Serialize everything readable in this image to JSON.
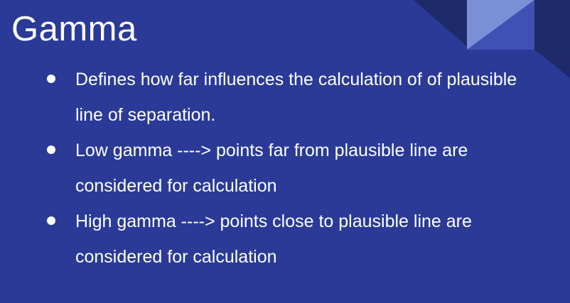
{
  "slide": {
    "title": "Gamma",
    "bullets": [
      {
        "text": "Defines how far influences the calculation of of plausible line of separation."
      },
      {
        "text": "Low gamma  ----> points far from plausible line are considered for calculation"
      },
      {
        "text": "High gamma  ----> points close to plausible line are considered for calculation"
      }
    ]
  },
  "colors": {
    "background": "#2a3a96",
    "text": "#ffffff",
    "accent_dark": "#1f2a6b",
    "accent_mid": "#3f51b5",
    "accent_light": "#7b8fd6"
  }
}
